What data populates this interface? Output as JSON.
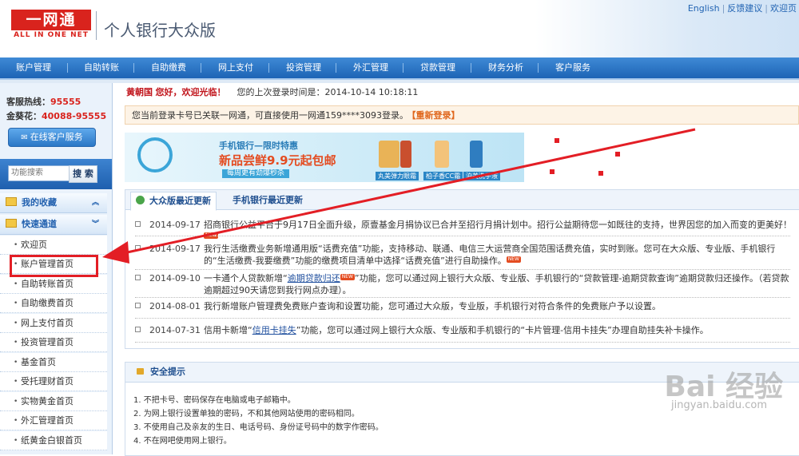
{
  "header": {
    "logo_main": "一网通",
    "logo_sub": "ALL IN ONE NET",
    "title": "个人银行大众版",
    "links": [
      "English",
      "反馈建议",
      "欢迎页"
    ]
  },
  "nav": [
    "账户管理",
    "自助转账",
    "自助缴费",
    "网上支付",
    "投资管理",
    "外汇管理",
    "贷款管理",
    "财务分析",
    "客户服务"
  ],
  "sidebar": {
    "hotline_label": "客服热线：",
    "hotline_number": "95555",
    "gold_label": "金葵花：",
    "gold_number": "40088-95555",
    "online_service": "在线客户服务",
    "search_placeholder": "功能搜索",
    "search_button": "搜 索",
    "favorites": "我的收藏",
    "quick": "快速通道",
    "items": [
      "欢迎页",
      "账户管理首页",
      "自助转账首页",
      "自助缴费首页",
      "网上支付首页",
      "投资管理首页",
      "基金首页",
      "受托理财首页",
      "实物黄金首页",
      "外汇管理首页",
      "纸黄金白银首页"
    ]
  },
  "main": {
    "user_name": "黄朝国",
    "greeting": "您好，欢迎光临！",
    "last_login_label": "您的上次登录时间是：",
    "last_login_time": "2014-10-14 10:18:11",
    "login_notice": "您当前登录卡号已关联一网通，可直接使用一网通159****3093登录。",
    "relogin": "【重新登录】",
    "banner": {
      "line1": "手机银行—限时特惠",
      "line2": "新品尝鲜9.9元起包邮",
      "line3": "每周更有劲爆秒杀",
      "products": [
        "丸美弹力眼霜",
        "柏子香CC霜",
        "泊美洗手液"
      ]
    },
    "tabs": [
      "大众版最近更新",
      "手机银行最近更新"
    ],
    "news": [
      {
        "date": "2014-09-17",
        "text": "招商银行公益平台于9月17日全面升级，原壹基金月捐协议已合并至招行月捐计划中。招行公益期待您一如既往的支持，世界因您的加入而变的更美好！",
        "link": ""
      },
      {
        "date": "2014-09-17",
        "text": "我行生活缴费业务新增通用版“话费充值”功能，支持移动、联通、电信三大运营商全国范围话费充值，实时到账。您可在大众版、专业版、手机银行的“生活缴费-我要缴费”功能的缴费项目清单中选择“话费充值”进行自助操作。",
        "link": ""
      },
      {
        "date": "2014-09-10",
        "pre": "一卡通个人贷款新增“",
        "link": "逾期贷款归还",
        "text": "”功能，您可以通过网上银行大众版、专业版、手机银行的“贷款管理-逾期贷款查询”逾期贷款归还操作。（若贷款逾期超过90天请您到我行网点办理）。"
      },
      {
        "date": "2014-08-01",
        "text": "我行新增账户管理费免费账户查询和设置功能，您可通过大众版，专业版，手机银行对符合条件的免费账户予以设置。",
        "link": ""
      },
      {
        "date": "2014-07-31",
        "pre": "信用卡新增“",
        "link": "信用卡挂失",
        "text": "”功能，您可以通过网上银行大众版、专业版和手机银行的“卡片管理-信用卡挂失”办理自助挂失补卡操作。"
      }
    ],
    "new_badge": "NEW",
    "safety_title": "安全提示",
    "tips": [
      "1. 不把卡号、密码保存在电脑或电子邮箱中。",
      "2. 为网上银行设置单独的密码，不和其他网站使用的密码相同。",
      "3. 不使用自己及亲友的生日、电话号码、身份证号码中的数字作密码。",
      "4. 不在网吧使用网上银行。"
    ]
  },
  "watermark": {
    "main": "Bai 经验",
    "sub": "jingyan.baidu.com"
  }
}
